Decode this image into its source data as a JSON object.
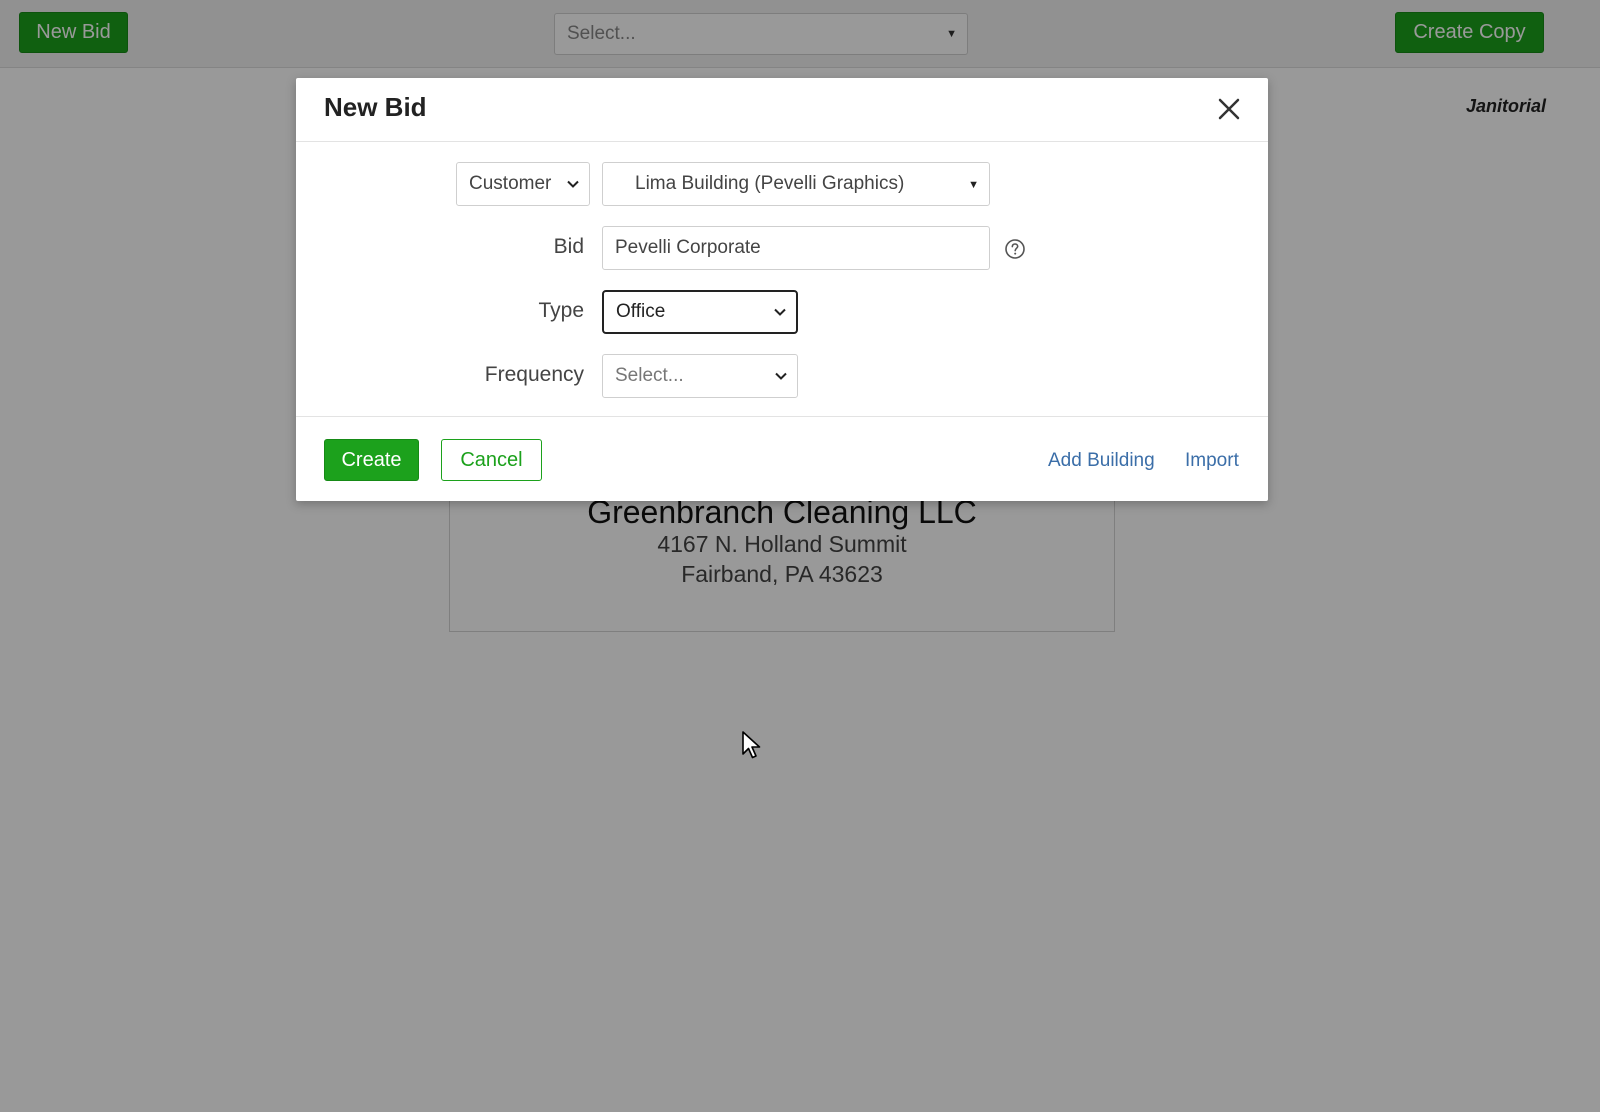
{
  "topbar": {
    "new_bid_label": "New Bid",
    "select_placeholder": "Select...",
    "create_copy_label": "Create Copy"
  },
  "category_label": "Janitorial",
  "company_card": {
    "name": "Greenbranch Cleaning LLC",
    "address_line1": "4167 N. Holland Summit",
    "address_line2": "Fairband, PA 43623"
  },
  "modal": {
    "title": "New Bid",
    "customer_mode": "Customer",
    "customer_value": "Lima Building (Pevelli Graphics)",
    "bid_label": "Bid",
    "bid_value": "Pevelli Corporate",
    "type_label": "Type",
    "type_value": "Office",
    "frequency_label": "Frequency",
    "frequency_value": "Select...",
    "create_label": "Create",
    "cancel_label": "Cancel",
    "add_building_label": "Add Building",
    "import_label": "Import"
  },
  "colors": {
    "primary_green": "#1ca11c",
    "link_blue": "#3b6ea8",
    "overlay": "rgba(0,0,0,0.4)"
  },
  "icons": [
    "close-icon",
    "help-icon",
    "chevron-down-icon",
    "dropdown-triangle-icon",
    "mouse-cursor-icon"
  ]
}
